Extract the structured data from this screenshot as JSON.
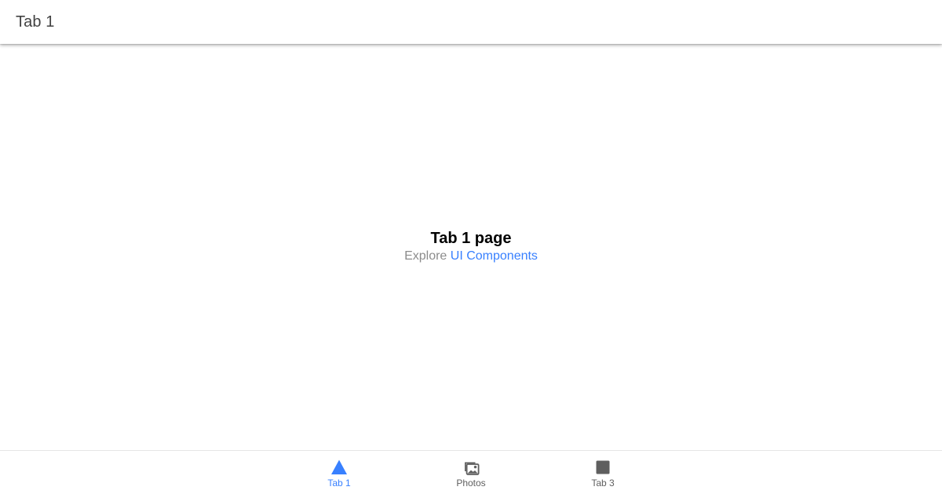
{
  "header": {
    "title": "Tab 1"
  },
  "main": {
    "heading": "Tab 1 page",
    "sub_prefix": "Explore",
    "sub_link": "UI Components"
  },
  "tabs": [
    {
      "label": "Tab 1",
      "icon": "triangle-icon",
      "selected": true
    },
    {
      "label": "Photos",
      "icon": "images-icon",
      "selected": false
    },
    {
      "label": "Tab 3",
      "icon": "square-icon",
      "selected": false
    }
  ],
  "colors": {
    "accent": "#3880ff",
    "icon_inactive": "#5f5f5f",
    "subtext": "#8c8c8c",
    "title": "#424242"
  }
}
